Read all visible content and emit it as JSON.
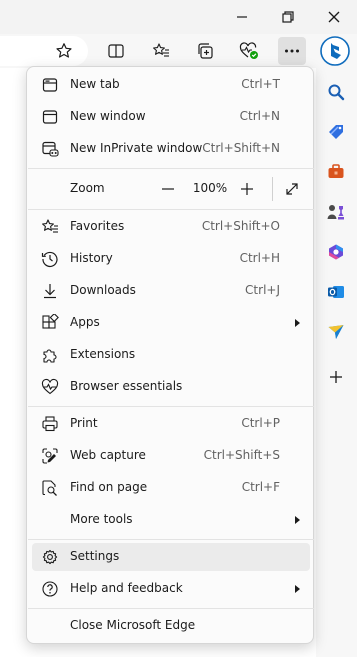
{
  "menu": {
    "items": [
      {
        "label": "New tab",
        "shortcut": "Ctrl+T"
      },
      {
        "label": "New window",
        "shortcut": "Ctrl+N"
      },
      {
        "label": "New InPrivate window",
        "shortcut": "Ctrl+Shift+N"
      },
      {
        "label": "Favorites",
        "shortcut": "Ctrl+Shift+O"
      },
      {
        "label": "History",
        "shortcut": "Ctrl+H"
      },
      {
        "label": "Downloads",
        "shortcut": "Ctrl+J"
      },
      {
        "label": "Apps",
        "shortcut": ""
      },
      {
        "label": "Extensions",
        "shortcut": ""
      },
      {
        "label": "Browser essentials",
        "shortcut": ""
      },
      {
        "label": "Print",
        "shortcut": "Ctrl+P"
      },
      {
        "label": "Web capture",
        "shortcut": "Ctrl+Shift+S"
      },
      {
        "label": "Find on page",
        "shortcut": "Ctrl+F"
      },
      {
        "label": "More tools",
        "shortcut": ""
      },
      {
        "label": "Settings",
        "shortcut": ""
      },
      {
        "label": "Help and feedback",
        "shortcut": ""
      },
      {
        "label": "Close Microsoft Edge",
        "shortcut": ""
      }
    ],
    "zoom": {
      "label": "Zoom",
      "value": "100%"
    }
  },
  "icons": {
    "window": [
      "minimize-icon",
      "restore-icon",
      "close-icon"
    ],
    "toolbar": [
      "favorite-star-icon",
      "split-screen-icon",
      "favorites-icon",
      "collections-icon",
      "browser-essentials-icon",
      "more-icon",
      "bing-copilot-icon"
    ],
    "sidebar": [
      "search-icon",
      "shopping-icon",
      "tools-icon",
      "games-icon",
      "microsoft-365-icon",
      "outlook-icon",
      "drop-icon",
      "add-icon"
    ]
  },
  "colors": {
    "accent": "#0f6cbd",
    "highlight": "#ebebeb",
    "status_green": "#13a10e"
  }
}
